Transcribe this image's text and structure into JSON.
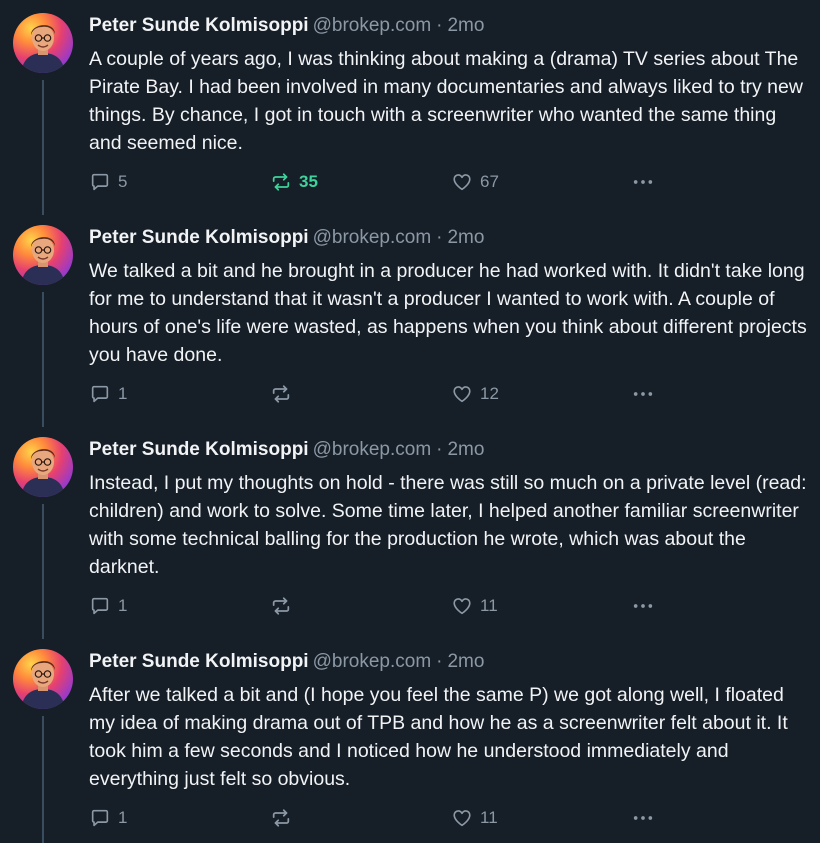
{
  "posts": [
    {
      "author": "Peter Sunde Kolmisoppi",
      "handle": "@brokep.com",
      "separator": "·",
      "time": "2mo",
      "text": "A couple of years ago, I was thinking about making a (drama) TV series about The Pirate Bay. I had been involved in many documentaries and always liked to try new things. By chance, I got in touch with a screenwriter who wanted the same thing and seemed nice.",
      "replies": "5",
      "reposts": "35",
      "reposted": true,
      "likes": "67"
    },
    {
      "author": "Peter Sunde Kolmisoppi",
      "handle": "@brokep.com",
      "separator": "·",
      "time": "2mo",
      "text": "We talked a bit and he brought in a producer he had worked with. It didn't take long for me to understand that it wasn't a producer I wanted to work with. A couple of hours of one's life were wasted, as happens when you think about different projects you have done.",
      "replies": "1",
      "reposts": "",
      "reposted": false,
      "likes": "12"
    },
    {
      "author": "Peter Sunde Kolmisoppi",
      "handle": "@brokep.com",
      "separator": "·",
      "time": "2mo",
      "text": "Instead, I put my thoughts on hold - there was still so much on a private level (read: children) and work to solve. Some time later, I helped another familiar screenwriter with some technical balling for the production he wrote, which was about the darknet.",
      "replies": "1",
      "reposts": "",
      "reposted": false,
      "likes": "11"
    },
    {
      "author": "Peter Sunde Kolmisoppi",
      "handle": "@brokep.com",
      "separator": "·",
      "time": "2mo",
      "text": "After we talked a bit and (I hope you feel the same P) we got along well, I floated my idea of making drama out of TPB and how he as a screenwriter felt about it. It took him a few seconds and I noticed how he understood immediately and everything just felt so obvious.",
      "replies": "1",
      "reposts": "",
      "reposted": false,
      "likes": "11"
    }
  ],
  "icons": {
    "reply": "reply-icon",
    "repost": "repost-icon",
    "like": "heart-icon",
    "more": "more-options-icon",
    "avatar": "avatar"
  },
  "colors": {
    "background": "#161e27",
    "text": "#f1f3f5",
    "muted": "#8b98a5",
    "repost_active": "#3ed39b",
    "thread_line": "#3a4d5f"
  }
}
